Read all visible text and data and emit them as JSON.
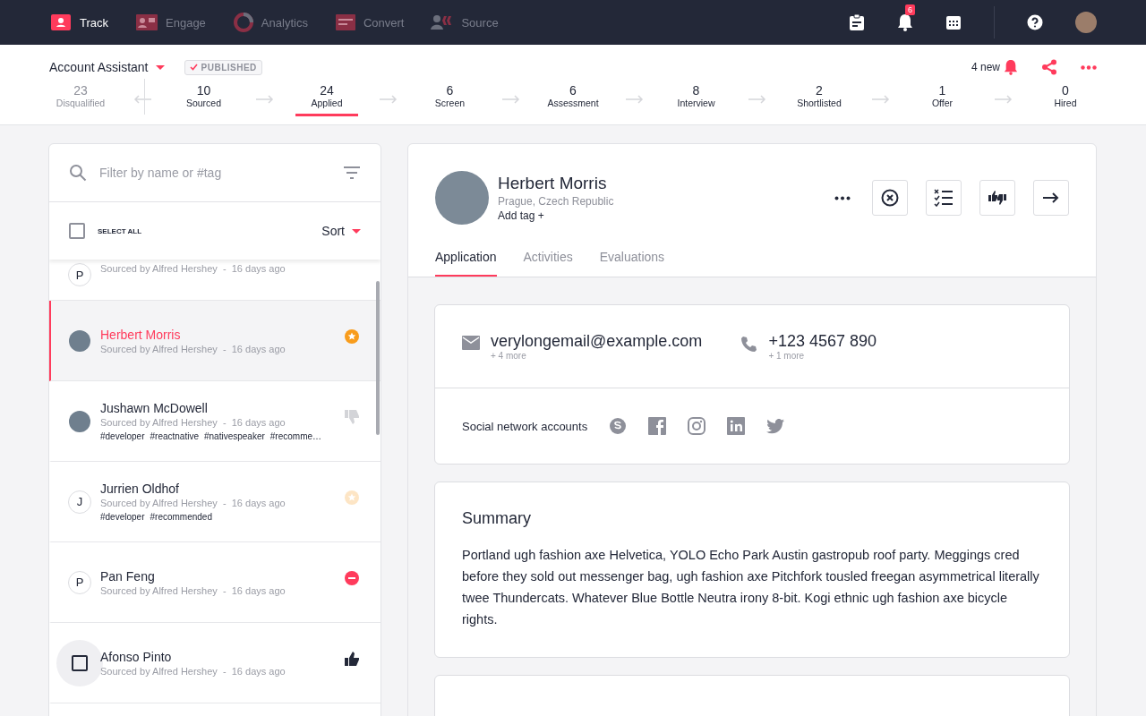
{
  "nav": [
    {
      "label": "Track",
      "kind": "track",
      "selected": true
    },
    {
      "label": "Engage",
      "kind": "engage",
      "selected": false
    },
    {
      "label": "Analytics",
      "kind": "analytics",
      "selected": false
    },
    {
      "label": "Convert",
      "kind": "convert",
      "selected": false
    },
    {
      "label": "Source",
      "kind": "source",
      "selected": false
    }
  ],
  "notification_count": "6",
  "job": {
    "title": "Account Assistant",
    "status": "PUBLISHED",
    "new_count": "4 new"
  },
  "stages": [
    {
      "count": "23",
      "label": "Disqualified",
      "kind": "disqualified",
      "selected": false
    },
    {
      "count": "10",
      "label": "Sourced",
      "kind": "stage",
      "selected": false
    },
    {
      "count": "24",
      "label": "Applied",
      "kind": "stage",
      "selected": true
    },
    {
      "count": "6",
      "label": "Screen",
      "kind": "stage",
      "selected": false
    },
    {
      "count": "6",
      "label": "Assessment",
      "kind": "stage",
      "selected": false
    },
    {
      "count": "8",
      "label": "Interview",
      "kind": "stage",
      "selected": false
    },
    {
      "count": "2",
      "label": "Shortlisted",
      "kind": "stage",
      "selected": false
    },
    {
      "count": "1",
      "label": "Offer",
      "kind": "stage",
      "selected": false
    },
    {
      "count": "0",
      "label": "Hired",
      "kind": "stage",
      "selected": false
    }
  ],
  "filter": {
    "placeholder": "Filter by name or #tag"
  },
  "select_all": {
    "label": "SELECT ALL",
    "checked": false
  },
  "sort": {
    "label": "Sort"
  },
  "candidates": [
    {
      "avatar": {
        "kind": "initial",
        "initial": "P"
      },
      "sourced": "Sourced by Alfred Hershey  -  16 days ago",
      "selected": false
    },
    {
      "avatar": {
        "kind": "photo"
      },
      "name": "Herbert Morris",
      "sourced": "Sourced by Alfred Hershey  -  16 days ago",
      "status": {
        "kind": "star"
      },
      "selected": true
    },
    {
      "avatar": {
        "kind": "photo"
      },
      "name": "Jushawn McDowell",
      "sourced": "Sourced by Alfred Hershey  -  16 days ago",
      "tags": [
        "#developer",
        "#reactnative",
        "#nativespeaker",
        "#recomme…"
      ],
      "status": {
        "kind": "thumbs-down"
      },
      "selected": false
    },
    {
      "avatar": {
        "kind": "initial",
        "initial": "J"
      },
      "name": "Jurrien Oldhof",
      "sourced": "Sourced by Alfred Hershey  -  16 days ago",
      "tags": [
        "#developer",
        "#recommended"
      ],
      "status": {
        "kind": "star-faded"
      },
      "selected": false
    },
    {
      "avatar": {
        "kind": "initial",
        "initial": "P"
      },
      "name": "Pan Feng",
      "sourced": "Sourced by Alfred Hershey  -  16 days ago",
      "status": {
        "kind": "rejected"
      },
      "selected": false
    },
    {
      "avatar": {
        "kind": "checkbox",
        "checked": false
      },
      "name": "Afonso Pinto",
      "sourced": "Sourced by Alfred Hershey  -  16 days ago",
      "status": {
        "kind": "thumbs-up"
      },
      "selected": false
    }
  ],
  "profile": {
    "name": "Herbert Morris",
    "location": "Prague, Czech Republic",
    "add_tag": "Add tag +"
  },
  "tabs": [
    {
      "label": "Application",
      "selected": true
    },
    {
      "label": "Activities",
      "selected": false
    },
    {
      "label": "Evaluations",
      "selected": false
    }
  ],
  "contact": {
    "email": "verylongemail@example.com",
    "email_more": "+ 4 more",
    "phone": "+123 4567 890",
    "phone_more": "+ 1 more"
  },
  "social": {
    "label": "Social network accounts",
    "networks": [
      {
        "kind": "skype"
      },
      {
        "kind": "facebook"
      },
      {
        "kind": "instagram"
      },
      {
        "kind": "linkedin"
      },
      {
        "kind": "twitter"
      }
    ]
  },
  "summary": {
    "title": "Summary",
    "text": "Portland ugh fashion axe Helvetica, YOLO Echo Park Austin gastropub roof party. Meggings cred before they sold out messenger bag, ugh fashion axe Pitchfork tousled freegan asymmetrical literally twee Thundercats. Whatever Blue Bottle Neutra irony 8-bit. Kogi ethnic ugh fashion axe bicycle rights."
  }
}
